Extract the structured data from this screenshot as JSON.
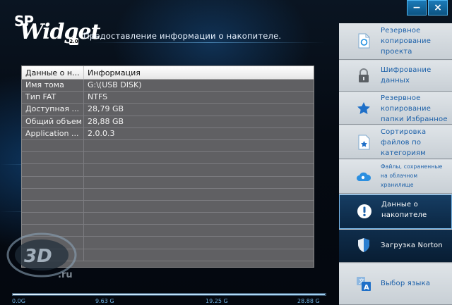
{
  "app": {
    "logo_sp": "SP",
    "logo_widget": "Widget",
    "logo_version": "2.0",
    "page_title": "Предоставление информации о накопителе."
  },
  "window": {
    "minimize_label": "−",
    "close_label": "×"
  },
  "table": {
    "columns": [
      "Данные о н...",
      "Информация"
    ],
    "rows": [
      [
        "Имя тома",
        "G:\\(USB DISK)"
      ],
      [
        "Тип FAT",
        "NTFS"
      ],
      [
        "Доступная ...",
        "28,79 GB"
      ],
      [
        "Общий объем",
        "28,88 GB"
      ],
      [
        "Application ...",
        "2.0.0.3"
      ],
      [
        "",
        ""
      ],
      [
        "",
        ""
      ],
      [
        "",
        ""
      ],
      [
        "",
        ""
      ],
      [
        "",
        ""
      ],
      [
        "",
        ""
      ],
      [
        "",
        ""
      ],
      [
        "",
        ""
      ],
      [
        "",
        ""
      ],
      [
        "",
        ""
      ]
    ]
  },
  "storage": {
    "used_fraction": 0.997,
    "ticks": [
      "0.0G",
      "9.63 G",
      "19.25 G",
      "28.88 G"
    ]
  },
  "watermark": {
    "text": "3DNews",
    "subtitle": "www.3dnews.ru"
  },
  "sidebar": {
    "items": [
      {
        "label": "Резервное копирование проекта",
        "icon": "backup-sync-icon"
      },
      {
        "label": "Шифрование данных",
        "icon": "lock-icon"
      },
      {
        "label": "Резервное копирование папки Избранное",
        "icon": "star-icon"
      },
      {
        "label": "Сортировка файлов по категориям",
        "icon": "document-star-icon"
      },
      {
        "label": "Файлы, сохраненные на облачном хранилище",
        "icon": "cloud-icon"
      },
      {
        "label": "Данные о накопителе",
        "icon": "info-icon"
      },
      {
        "label": "Загрузка  Norton",
        "icon": "shield-icon"
      },
      {
        "label": "Выбор языка",
        "icon": "language-icon"
      }
    ]
  },
  "colors": {
    "accent": "#1a5fa8",
    "active_bg": "#163d63",
    "table_bg": "#606063"
  }
}
